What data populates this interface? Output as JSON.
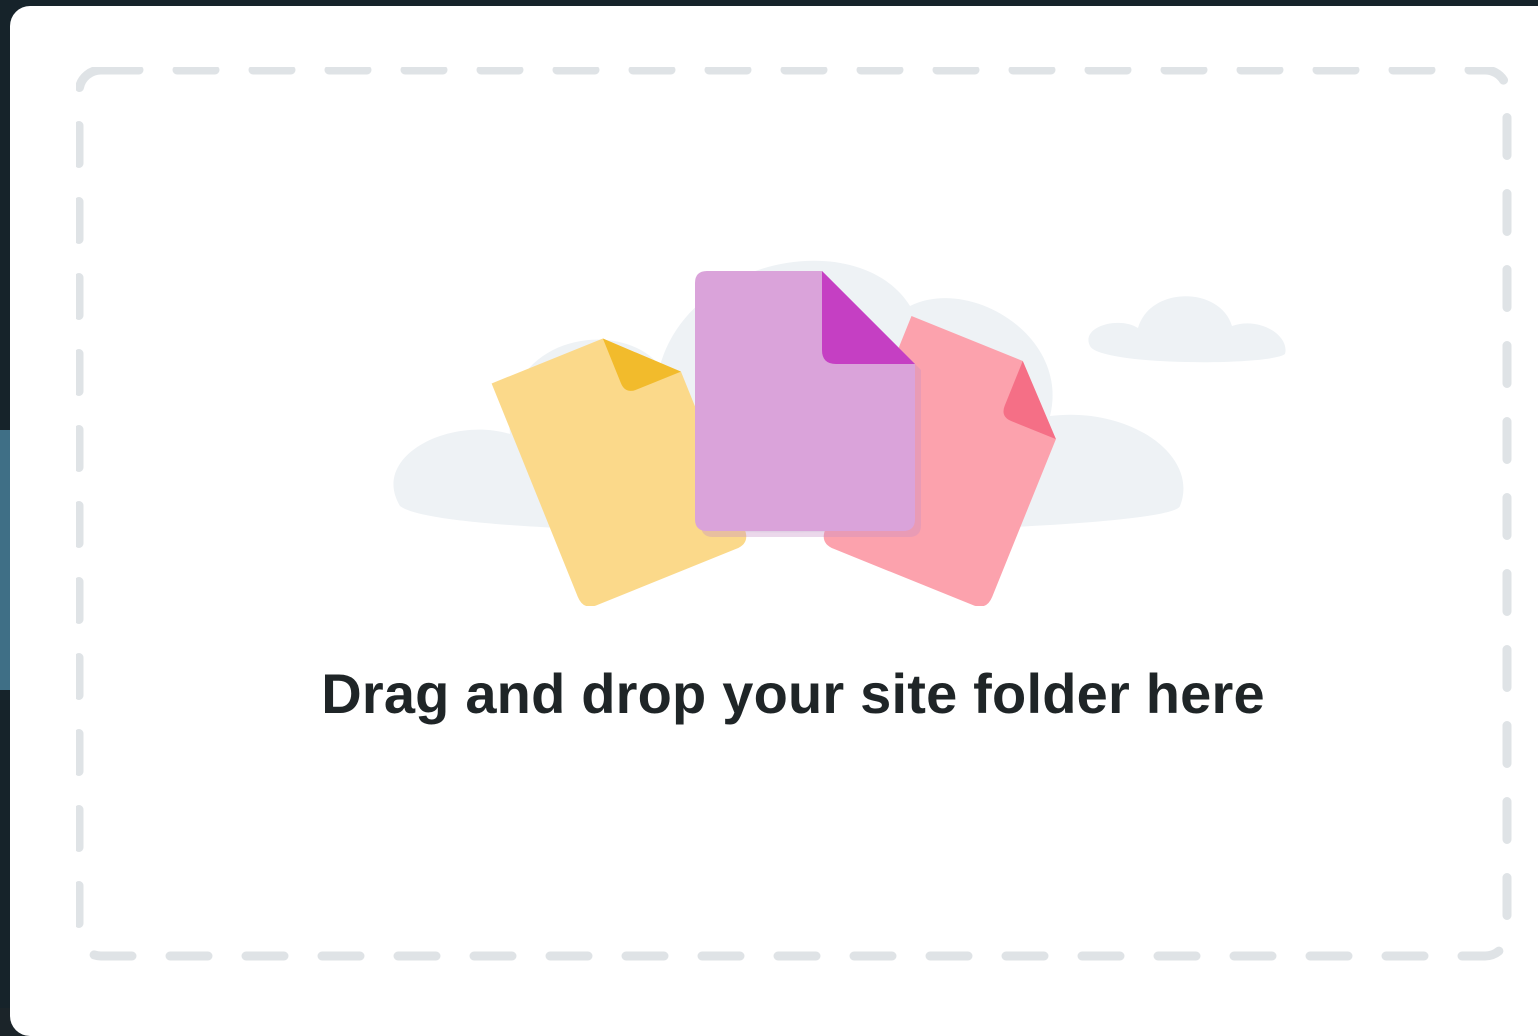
{
  "dropzone": {
    "prompt": "Drag and drop your site folder here",
    "border_color": "#dfe3e6",
    "illustration": {
      "icons": [
        "cloud-icon",
        "cloud-small-icon",
        "file-yellow-icon",
        "file-purple-icon",
        "file-pink-icon"
      ],
      "colors": {
        "cloud": "#eef2f5",
        "file_yellow": "#fbd98a",
        "file_yellow_fold": "#f2bb2c",
        "file_purple": "#daa3da",
        "file_purple_fold": "#c53fc3",
        "file_pink": "#fca2ad",
        "file_pink_fold": "#f56f86"
      }
    }
  }
}
